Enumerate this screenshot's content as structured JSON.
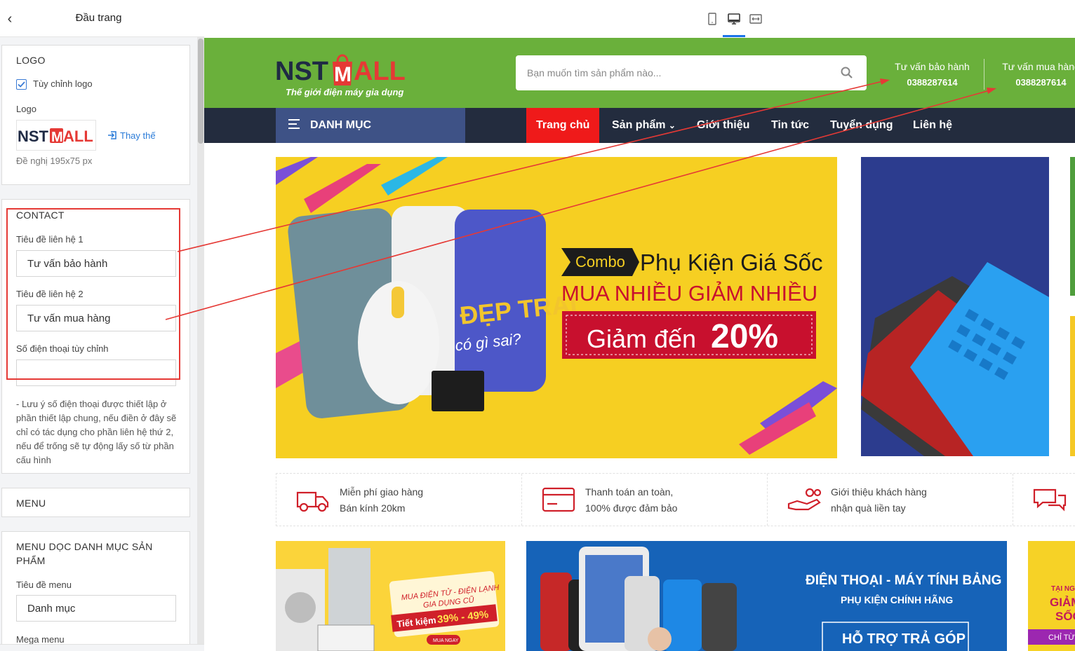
{
  "panel": {
    "title": "Đầu trang",
    "logo_section": {
      "title": "LOGO",
      "custom_logo_label": "Tùy chỉnh logo",
      "custom_logo_checked": true,
      "logo_label": "Logo",
      "replace_label": "Thay thế",
      "hint": "Đề nghị 195x75 px"
    },
    "contact_section": {
      "title": "CONTACT",
      "title1_label": "Tiêu đề liên hệ 1",
      "title1_value": "Tư vấn bảo hành",
      "title2_label": "Tiêu đề liên hệ 2",
      "title2_value": "Tư vấn mua hàng",
      "phone_label": "Số điện thoại tùy chỉnh",
      "phone_value": "",
      "note": "- Lưu ý số điện thoại được thiết lập ở phần thiết lập chung, nếu điền ở đây sẽ chỉ có tác dụng cho phần liên hệ thứ 2, nếu để trống sẽ tự động lấy số từ phần cấu hình"
    },
    "menu_section": {
      "title": "MENU"
    },
    "vertical_menu_section": {
      "title": "MENU DỌC DANH MỤC SẢN PHẨM",
      "menu_title_label": "Tiêu đề menu",
      "menu_title_value": "Danh mục",
      "mega_menu_label": "Mega menu"
    }
  },
  "device_bar": {
    "icons": [
      "mobile-icon",
      "desktop-icon",
      "fullwidth-icon"
    ],
    "active": "desktop-icon"
  },
  "site": {
    "logo_text_1": "NST",
    "logo_text_2": "MALL",
    "logo_tagline": "Thế giới điện máy gia dụng",
    "search_placeholder": "Bạn muốn tìm sản phẩm nào...",
    "contact1": {
      "title": "Tư vấn bảo hành",
      "phone": "0388287614"
    },
    "contact2": {
      "title": "Tư vấn mua hàng",
      "phone": "0388287614"
    },
    "category_button": "DANH MỤC",
    "nav": [
      "Trang chủ",
      "Sản phẩm",
      "Giới thiệu",
      "Tin tức",
      "Tuyển dụng",
      "Liên hệ"
    ],
    "banner": {
      "combo": "Combo",
      "headline": "Phụ Kiện Giá Sốc",
      "subline": "MUA NHIỀU GIẢM NHIỀU",
      "discount_prefix": "Giảm đến",
      "discount_value": "20%",
      "phone_case_text_1": "ĐẸP TRAI",
      "phone_case_text_2": "có gì sai?"
    },
    "features": [
      {
        "icon": "truck-icon",
        "line1": "Miễn phí giao hàng",
        "line2": "Bán kính 20km"
      },
      {
        "icon": "card-icon",
        "line1": "Thanh toán an toàn,",
        "line2": "100% được đảm bảo"
      },
      {
        "icon": "gift-hand-icon",
        "line1": "Giới thiệu khách hàng",
        "line2": "nhận quà liền tay"
      },
      {
        "icon": "chat-icon",
        "line1": "",
        "line2": ""
      }
    ],
    "promo1": {
      "line1": "MUA ĐIỆN TỬ - ĐIỆN LẠNH",
      "line2": "GIA DỤNG CŨ",
      "save_prefix": "Tiết kiệm",
      "save_value": "39% - 49%",
      "cta": "MUA NGAY"
    },
    "promo2": {
      "title": "ĐIỆN THOẠI - MÁY TÍNH BẢNG",
      "subtitle": "PHỤ KIỆN CHÍNH HÃNG",
      "cta": "HỖ TRỢ TRẢ GÓP"
    },
    "promo3": {
      "line1": "TẠI NG",
      "line2": "GIẢM",
      "line3": "SỐC",
      "line4": "CHỈ TỪ"
    }
  },
  "colors": {
    "header_green": "#6ab03b",
    "nav_dark": "#232c3e",
    "category_blue": "#3e5286",
    "active_red": "#ef1a1a",
    "annotation_red": "#e53935",
    "link_blue": "#2a7bd8"
  }
}
